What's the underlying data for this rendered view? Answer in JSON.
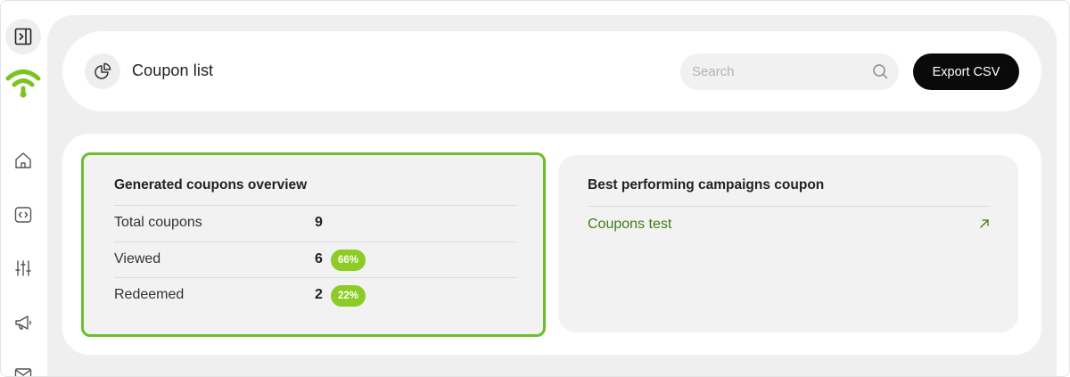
{
  "sidebar": {
    "toggle_icon": "sidebar-expand-icon",
    "logo_icon": "wifi-icon",
    "brand_color": "#7cc321",
    "items": [
      {
        "icon": "home-icon"
      },
      {
        "icon": "code-icon"
      },
      {
        "icon": "sliders-icon"
      },
      {
        "icon": "megaphone-icon"
      },
      {
        "icon": "mail-icon"
      }
    ]
  },
  "header": {
    "icon": "pie-chart-icon",
    "title": "Coupon list",
    "search": {
      "placeholder": "Search",
      "value": ""
    },
    "export_label": "Export CSV"
  },
  "overview": {
    "title": "Generated coupons overview",
    "highlight_color": "#6abf2a",
    "rows": [
      {
        "label": "Total coupons",
        "value": "9",
        "badge": ""
      },
      {
        "label": "Viewed",
        "value": "6",
        "badge": "66%"
      },
      {
        "label": "Redeemed",
        "value": "2",
        "badge": "22%"
      }
    ]
  },
  "best": {
    "title": "Best performing campaigns coupon",
    "items": [
      {
        "label": "Coupons test",
        "icon": "arrow-up-right-icon"
      }
    ]
  }
}
